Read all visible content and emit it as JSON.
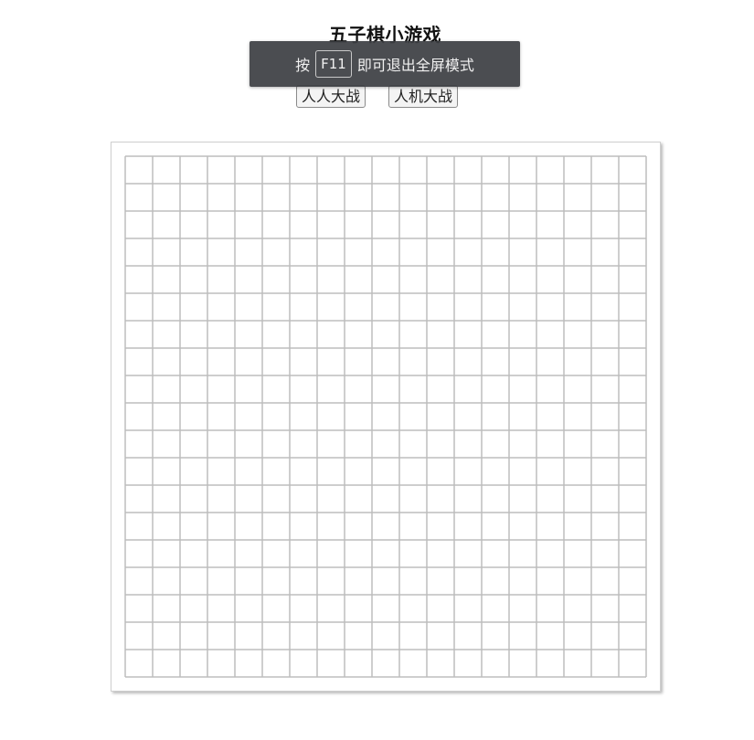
{
  "game": {
    "title": "五子棋小游戏"
  },
  "fullscreen_notice": {
    "prefix": "按",
    "key": "F11",
    "suffix": "即可退出全屏模式"
  },
  "modes": {
    "pvp_label": "人人大战",
    "pve_label": "人机大战"
  },
  "board": {
    "cells_per_side": 19,
    "line_color": "#bdbdbd",
    "background": "#ffffff"
  }
}
